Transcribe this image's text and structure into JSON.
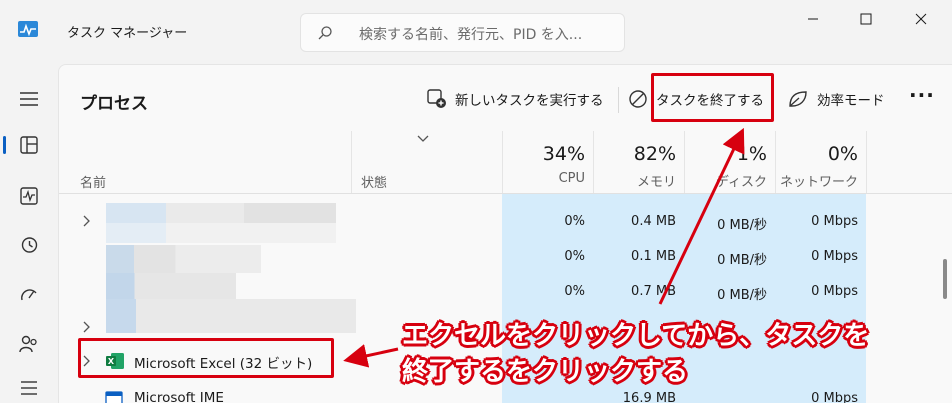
{
  "window": {
    "title": "タスク マネージャー",
    "search_placeholder": "検索する名前、発行元、PID を入..."
  },
  "toolbar": {
    "page_title": "プロセス",
    "new_task_label": "新しいタスクを実行する",
    "end_task_label": "タスクを終了する",
    "efficiency_label": "効率モード"
  },
  "columns": {
    "name": "名前",
    "status": "状態",
    "cpu_pct": "34%",
    "cpu": "CPU",
    "memory_pct": "82%",
    "memory": "メモリ",
    "disk_pct": "1%",
    "disk": "ディスク",
    "network_pct": "0%",
    "network": "ネットワーク"
  },
  "rows": [
    {
      "cpu": "0%",
      "memory": "0.4 MB",
      "disk": "0 MB/秒",
      "network": "0 Mbps"
    },
    {
      "cpu": "0%",
      "memory": "0.1 MB",
      "disk": "0 MB/秒",
      "network": "0 Mbps"
    },
    {
      "cpu": "0%",
      "memory": "0.7 MB",
      "disk": "0 MB/秒",
      "network": "0 Mbps"
    }
  ],
  "excel_row": {
    "name": "Microsoft Excel (32 ビット)"
  },
  "ime_row": {
    "name": "Microsoft IME",
    "memory": "16.9 MB",
    "network": "0 Mbps"
  },
  "annotation": {
    "line1": "エクセルをクリックしてから、タスクを",
    "line2": "終了するをクリックする"
  },
  "colors": {
    "accent": "#0a5fc2",
    "highlight": "#d7000f",
    "metric_bg": "#d5ecfb"
  }
}
